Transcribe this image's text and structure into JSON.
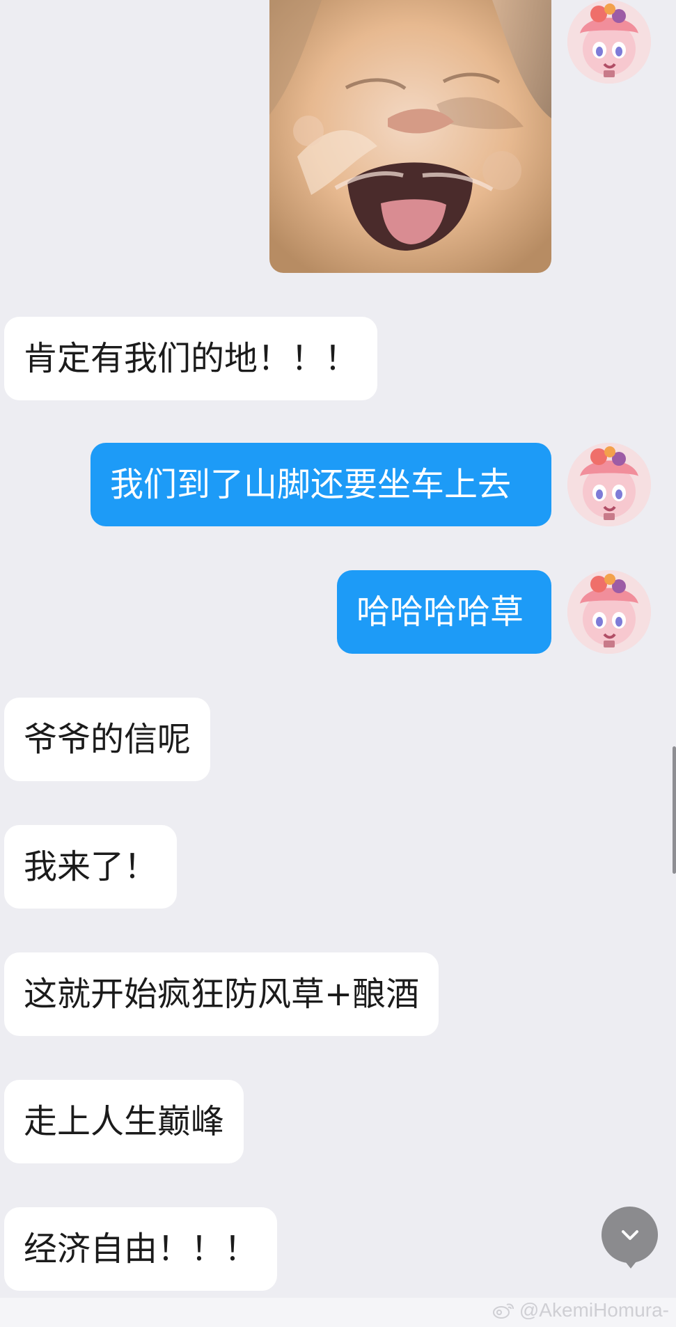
{
  "chat": {
    "messages": [
      {
        "side": "out",
        "text": "肯定有我们的地！！！",
        "kind": "text"
      },
      {
        "side": "out",
        "text": "我们到了山脚还要坐车上去",
        "kind": "text"
      },
      {
        "side": "out",
        "text": "哈哈哈哈草",
        "kind": "text"
      },
      {
        "side": "in",
        "text": "爷爷的信呢",
        "kind": "text"
      },
      {
        "side": "in",
        "text": "我来了！",
        "kind": "text"
      },
      {
        "side": "in",
        "text": "这就开始疯狂防风草+酿酒",
        "kind": "text"
      },
      {
        "side": "in",
        "text": "走上人生巅峰",
        "kind": "text"
      },
      {
        "side": "in",
        "text": "经济自由！！！",
        "kind": "text"
      }
    ]
  },
  "photo": {
    "subject": "cat-meme-image"
  },
  "controls": {
    "jump_icon": "chevron-down-icon"
  },
  "watermark": {
    "text": "@AkemiHomura-",
    "icon": "weibo-icon"
  },
  "colors": {
    "background": "#ededf2",
    "incoming_bubble": "#ffffff",
    "outgoing_bubble": "#1d9bf7",
    "incoming_text": "#1b1b1b",
    "outgoing_text": "#ffffff"
  }
}
